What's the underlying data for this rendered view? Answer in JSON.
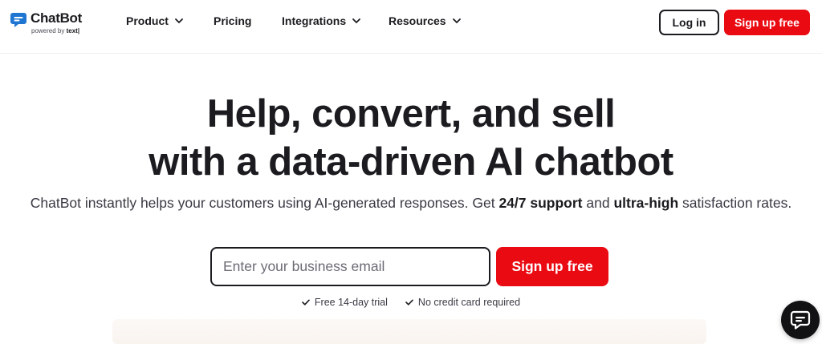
{
  "brand": {
    "name": "ChatBot",
    "tagline_prefix": "powered by",
    "tagline_brand": "text|",
    "color": "#1f76d2"
  },
  "nav": {
    "items": [
      {
        "label": "Product",
        "has_dropdown": true
      },
      {
        "label": "Pricing",
        "has_dropdown": false
      },
      {
        "label": "Integrations",
        "has_dropdown": true
      },
      {
        "label": "Resources",
        "has_dropdown": true
      }
    ],
    "login_label": "Log in",
    "signup_label": "Sign up free"
  },
  "hero": {
    "title_line1": "Help, convert, and sell",
    "title_line2": "with a data-driven AI chatbot",
    "subtitle_part1": "ChatBot instantly helps your customers using AI-generated responses. Get ",
    "subtitle_bold1": "24/7 support",
    "subtitle_part2": " and ",
    "subtitle_bold2": "ultra-high",
    "subtitle_part3": " satisfaction rates.",
    "email_placeholder": "Enter your business email",
    "email_value": "",
    "cta_label": "Sign up free",
    "perks": [
      "Free 14-day trial",
      "No credit card required"
    ]
  },
  "colors": {
    "accent": "#ea0a12",
    "text": "#1b1b20",
    "widget": "#121214"
  },
  "icons": {
    "logo": "chat-bubble-icon",
    "dropdown": "chevron-down-icon",
    "perk": "check-icon",
    "widget": "chat-widget-icon"
  }
}
